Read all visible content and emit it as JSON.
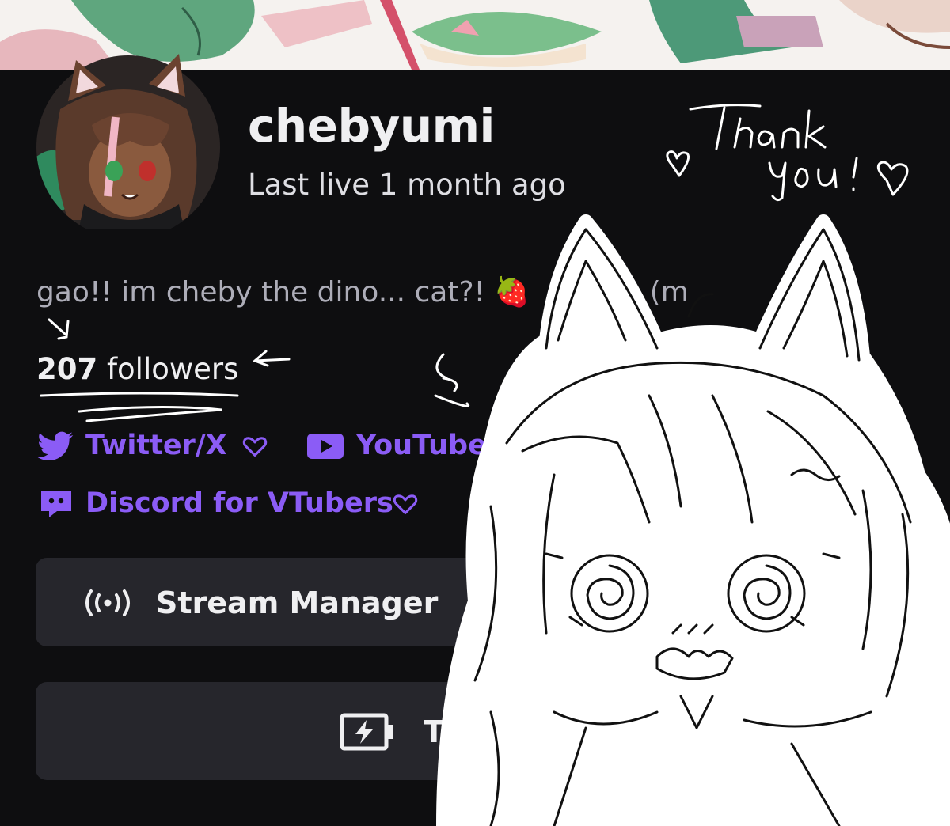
{
  "profile": {
    "username": "chebyumi",
    "last_live": "Last live 1 month ago",
    "bio": "gao!! im cheby the dino... cat?! 🍓",
    "bio_cutoff": "(m",
    "followers_count": "207",
    "followers_label": "followers"
  },
  "links": {
    "twitter": "Twitter/X",
    "youtube": "YouTube",
    "discord": "Discord for VTubers"
  },
  "buttons": {
    "stream_manager": "Stream Manager",
    "try_ad": "Try A"
  },
  "handwritten_note": "Thank you!",
  "colors": {
    "background": "#0e0e10",
    "accent": "#8b5cf6",
    "button_bg": "#26262c",
    "text_primary": "#efeff1",
    "text_secondary": "#adadb8"
  },
  "icons": [
    "twitter-icon",
    "heart-icon",
    "youtube-icon",
    "discord-icon",
    "broadcast-icon",
    "battery-bolt-icon"
  ]
}
